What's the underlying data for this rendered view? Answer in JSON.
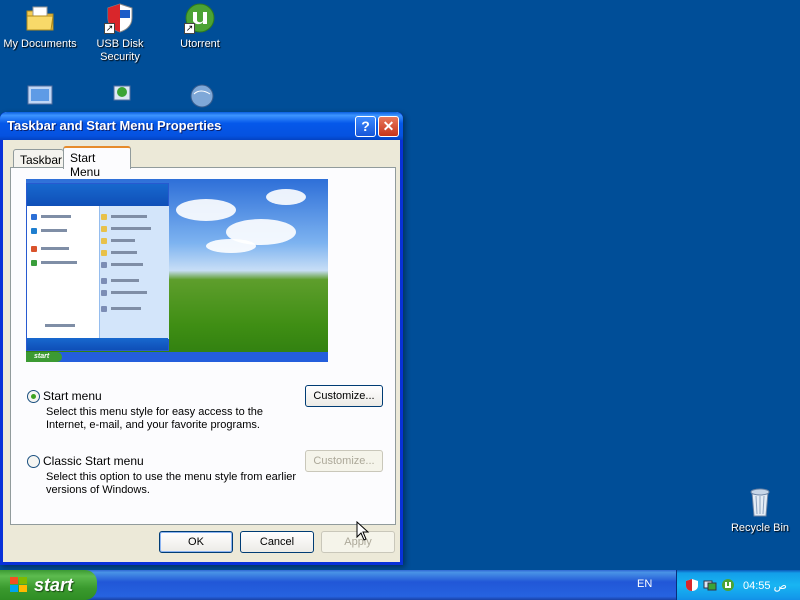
{
  "desktop": {
    "icons": [
      {
        "label": "My Documents",
        "icon": "folder-documents-icon"
      },
      {
        "label": "USB Disk Security",
        "icon": "usb-security-shield-icon"
      },
      {
        "label": "Utorrent",
        "icon": "utorrent-icon"
      },
      {
        "label": "",
        "icon": "computer-icon"
      },
      {
        "label": "",
        "icon": "network-shortcut-icon"
      },
      {
        "label": "",
        "icon": "globe-shortcut-icon"
      },
      {
        "label": "Recycle Bin",
        "icon": "recycle-bin-icon"
      }
    ],
    "background_color": "#004E98"
  },
  "dialog": {
    "title": "Taskbar and Start Menu Properties",
    "help_glyph": "?",
    "close_glyph": "✕",
    "tabs": [
      "Taskbar",
      "Start Menu"
    ],
    "active_tab": "Start Menu",
    "options": [
      {
        "label": "Start menu",
        "description": "Select this menu style for easy access to the Internet, e-mail, and your favorite programs.",
        "checked": true,
        "customize_label": "Customize...",
        "customize_enabled": true
      },
      {
        "label": "Classic Start menu",
        "description": "Select this option to use the menu style from earlier versions of Windows.",
        "checked": false,
        "customize_label": "Customize...",
        "customize_enabled": false
      }
    ],
    "buttons": {
      "ok": "OK",
      "cancel": "Cancel",
      "apply": "Apply"
    }
  },
  "taskbar": {
    "start_label": "start",
    "language": "EN",
    "clock": "04:55 ص",
    "tray_icons": [
      "usb-security-tray-icon",
      "network-tray-icon",
      "utorrent-tray-icon"
    ]
  },
  "colors": {
    "titlebar": "#0558EA",
    "start_button": "#3C9A33",
    "dialog_bg": "#ECE9D8",
    "tray": "#18B5F2"
  }
}
